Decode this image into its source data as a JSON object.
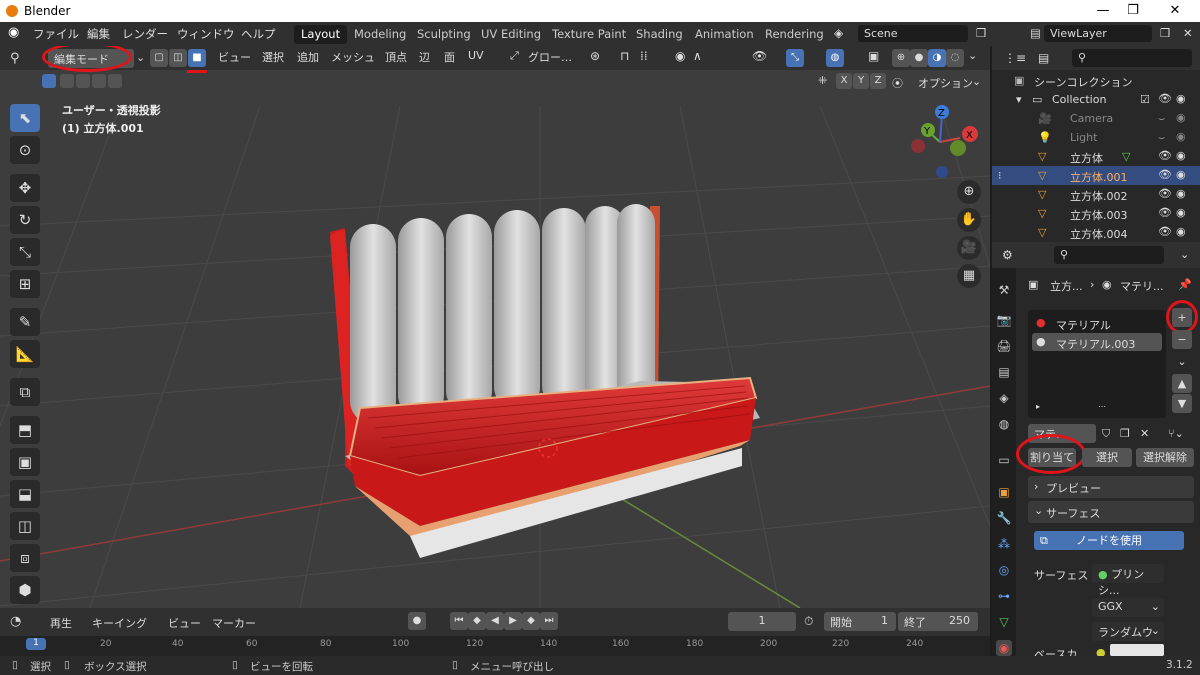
{
  "app": {
    "title": "Blender",
    "version": "3.1.2"
  },
  "menu": {
    "items": [
      "ファイル",
      "編集",
      "レンダー",
      "ウィンドウ",
      "ヘルプ"
    ]
  },
  "workspaces": [
    "Layout",
    "Modeling",
    "Sculpting",
    "UV Editing",
    "Texture Paint",
    "Shading",
    "Animation",
    "Rendering"
  ],
  "active_workspace": "Layout",
  "scene": {
    "name": "Scene",
    "view_layer": "ViewLayer"
  },
  "viewport_header": {
    "mode": "編集モード",
    "menus": [
      "ビュー",
      "選択",
      "追加",
      "メッシュ",
      "頂点",
      "辺",
      "面",
      "UV"
    ],
    "transform_orientation": "グロー…",
    "xyz": [
      "X",
      "Y",
      "Z"
    ],
    "options": "オプション"
  },
  "viewport": {
    "view_label": "ユーザー・透視投影",
    "object_label": "(1) 立方体.001"
  },
  "gizmo": {
    "x": "X",
    "y": "Y",
    "z": "Z"
  },
  "outliner": {
    "root": "シーンコレクション",
    "collection": "Collection",
    "items": [
      "Camera",
      "Light",
      "立方体",
      "立方体.001",
      "立方体.002",
      "立方体.003",
      "立方体.004"
    ],
    "selected": "立方体.001"
  },
  "properties": {
    "breadcrumb_object": "立方...",
    "breadcrumb_material": "マテリ...",
    "material_slots": [
      "マテリアル",
      "マテリアル.003"
    ],
    "slot_field": "マテ...",
    "assign": "割り当て",
    "select": "選択",
    "deselect": "選択解除",
    "preview": "プレビュー",
    "surface": "サーフェス",
    "use_nodes": "ノードを使用",
    "surface_label": "サーフェス",
    "surface_value": "プリンシ...",
    "distribution": "GGX",
    "subsurface": "ランダムウ",
    "base_color": "ベースカ..."
  },
  "timeline": {
    "menus": [
      "再生",
      "キーイング",
      "ビュー",
      "マーカー"
    ],
    "current_frame": "1",
    "start_label": "開始",
    "start": "1",
    "end_label": "終了",
    "end": "250",
    "ticks": [
      "1",
      "20",
      "40",
      "60",
      "80",
      "100",
      "120",
      "140",
      "160",
      "180",
      "200",
      "220",
      "240"
    ]
  },
  "statusbar": {
    "select": "選択",
    "box_select": "ボックス選択",
    "rotate_view": "ビューを回転",
    "call_menu": "メニュー呼び出し",
    "version": "3.1.2"
  },
  "colors": {
    "accent": "#4772b3",
    "annotation": "#e0141b",
    "seat_red": "#d11f1f",
    "cushion_gray": "#c9c9c9"
  }
}
